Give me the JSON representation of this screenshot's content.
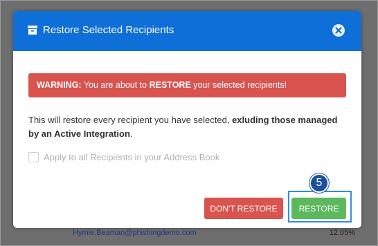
{
  "modal": {
    "title": "Restore Selected Recipients",
    "title_icon": "archive-box-icon",
    "close_icon": "close-circle-icon"
  },
  "warning": {
    "prefix": "WARNING:",
    "text_before": " You are about to ",
    "emphasis": "RESTORE",
    "text_after": " your selected recipients!"
  },
  "body": {
    "text_plain": "This will restore every recipient you have selected, ",
    "text_bold": "exluding those managed by an Active Integration",
    "text_end": "."
  },
  "apply_all": {
    "label": "Apply to all Recipients in your Address Book",
    "checked": false
  },
  "buttons": {
    "dont_restore": "DON'T RESTORE",
    "restore": "RESTORE"
  },
  "annotation": {
    "step": "5"
  },
  "background": {
    "email": "Hymie.Beaman@phishingdemo.com",
    "percent": "12.05%"
  },
  "colors": {
    "header": "#0f6fd8",
    "danger": "#d9534f",
    "success": "#5cb85c",
    "callout": "#2f8fd8"
  }
}
